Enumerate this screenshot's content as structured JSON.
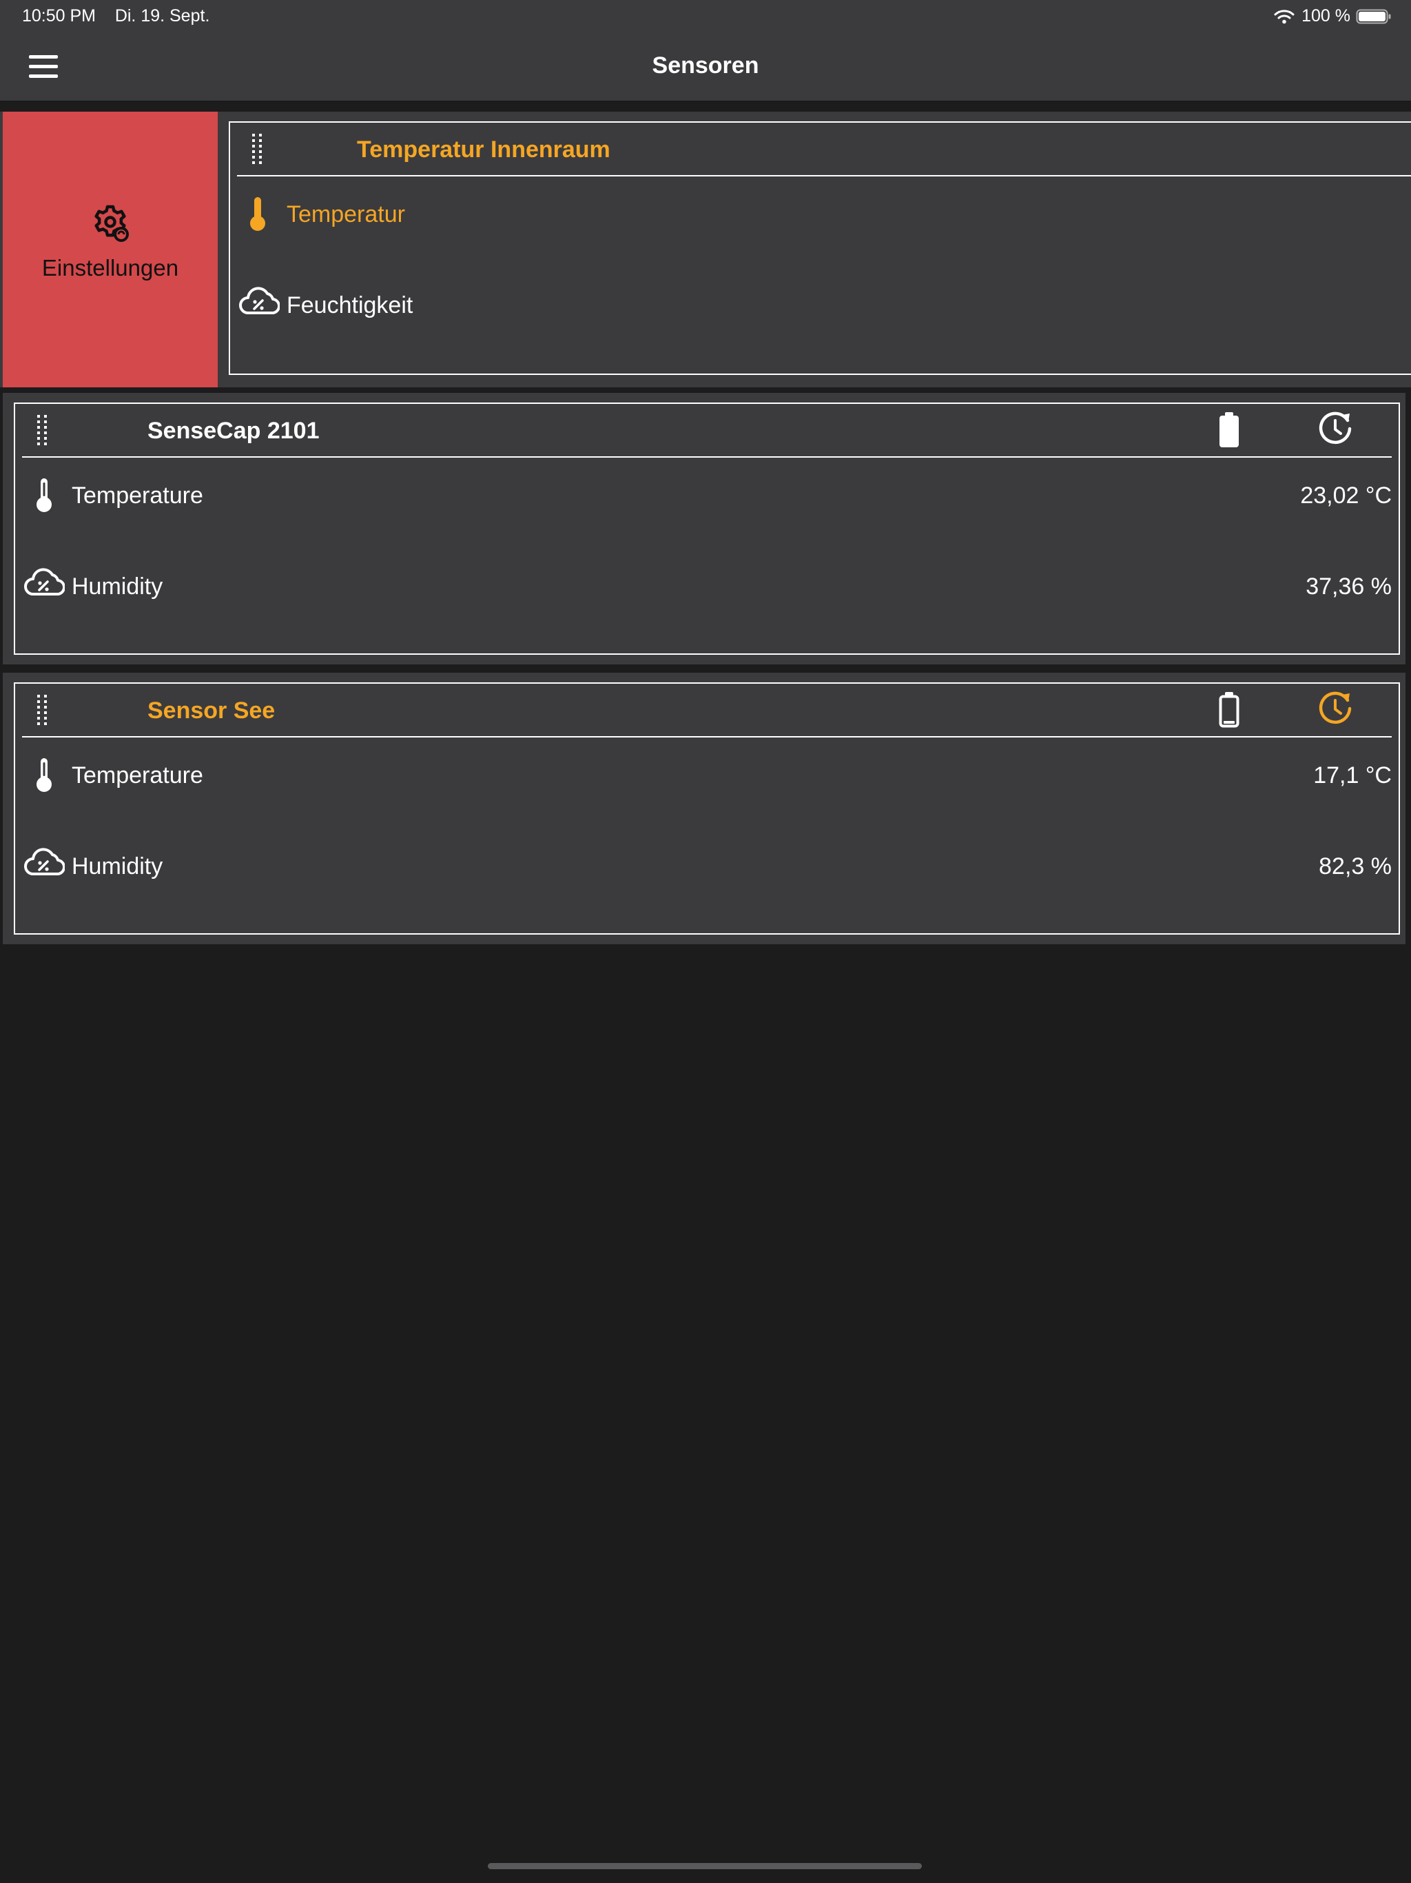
{
  "status_bar": {
    "time": "10:50 PM",
    "date": "Di. 19. Sept.",
    "battery_text": "100 %",
    "battery_level_pct": 100
  },
  "nav": {
    "title": "Sensoren",
    "menu_icon": "hamburger-menu-icon"
  },
  "swipe_action": {
    "label": "Einstellungen",
    "icon": "gear-icon",
    "color": "#d4494b"
  },
  "colors": {
    "accent": "#f5a623",
    "card_bg": "#3b3b3e",
    "page_bg": "#1c1c1d",
    "text": "#ffffff"
  },
  "sensors": [
    {
      "name": "Temperatur Innenraum",
      "highlighted": true,
      "readings": [
        {
          "label": "Temperatur",
          "value": "",
          "icon": "thermometer-icon",
          "highlighted": true
        },
        {
          "label": "Feuchtigkeit",
          "value": "",
          "icon": "humidity-cloud-icon",
          "highlighted": false
        }
      ]
    },
    {
      "name": "SenseCap 2101",
      "highlighted": false,
      "battery_icon": "battery-full-icon",
      "history_icon": "history-icon",
      "readings": [
        {
          "label": "Temperature",
          "value": "23,02 °C",
          "icon": "thermometer-icon"
        },
        {
          "label": "Humidity",
          "value": "37,36 %",
          "icon": "humidity-cloud-icon"
        }
      ]
    },
    {
      "name": "Sensor See",
      "highlighted": true,
      "battery_icon": "battery-low-icon",
      "history_icon": "history-icon",
      "readings": [
        {
          "label": "Temperature",
          "value": "17,1 °C",
          "icon": "thermometer-icon"
        },
        {
          "label": "Humidity",
          "value": "82,3 %",
          "icon": "humidity-cloud-icon"
        }
      ]
    }
  ]
}
